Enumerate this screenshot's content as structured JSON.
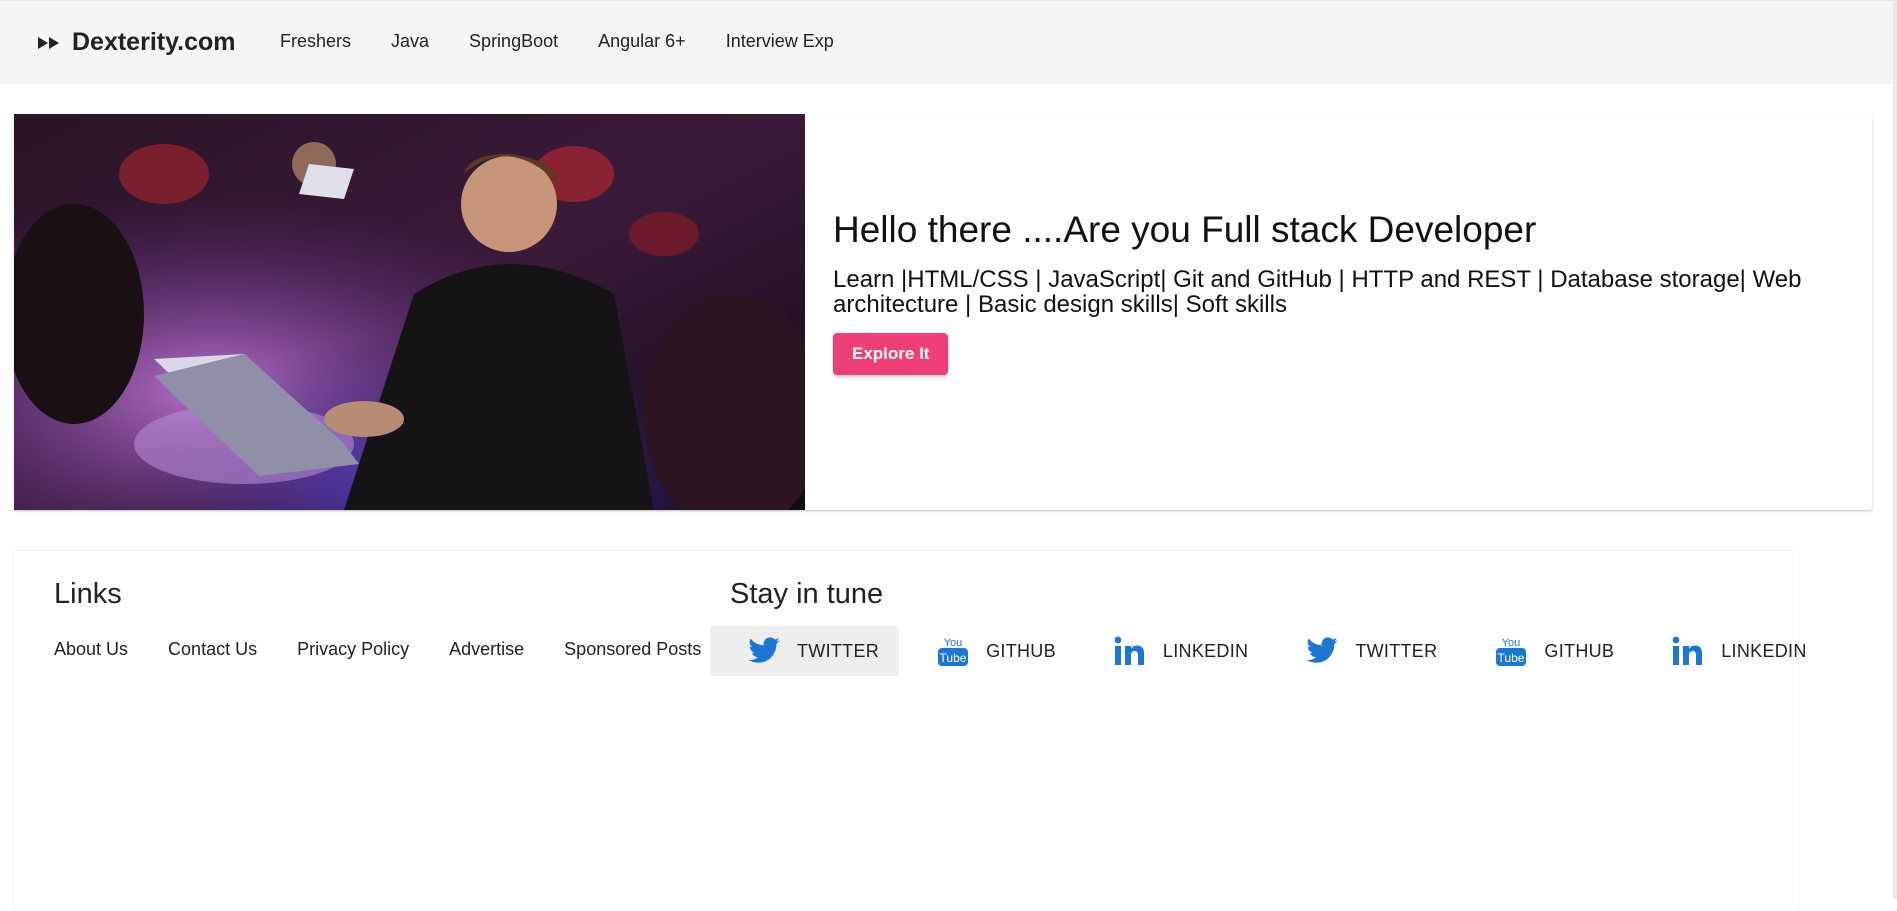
{
  "brand": {
    "name": "Dexterity.com",
    "icon": "fast-forward-icon"
  },
  "nav": {
    "items": [
      {
        "label": "Freshers"
      },
      {
        "label": "Java"
      },
      {
        "label": "SpringBoot"
      },
      {
        "label": "Angular 6+"
      },
      {
        "label": "Interview Exp"
      }
    ]
  },
  "hero": {
    "image": "developer-working-on-laptop-photo",
    "title": "Hello there ....Are you Full stack Developer",
    "subtitle": "Learn |HTML/CSS | JavaScript| Git and GitHub | HTTP and REST | Database storage| Web architecture | Basic design skills| Soft skills",
    "button_label": "Explore It"
  },
  "footer": {
    "links_title": "Links",
    "links": [
      {
        "label": "About Us"
      },
      {
        "label": "Contact Us"
      },
      {
        "label": "Privacy Policy"
      },
      {
        "label": "Advertise"
      },
      {
        "label": "Sponsored Posts"
      }
    ],
    "social_title": "Stay in tune",
    "social": [
      {
        "label": "TWITTER",
        "icon": "twitter-icon"
      },
      {
        "label": "GITHUB",
        "icon": "youtube-icon"
      },
      {
        "label": "LINKEDIN",
        "icon": "linkedin-icon"
      },
      {
        "label": "TWITTER",
        "icon": "twitter-icon"
      },
      {
        "label": "GITHUB",
        "icon": "youtube-icon"
      },
      {
        "label": "LINKEDIN",
        "icon": "linkedin-icon"
      }
    ]
  },
  "colors": {
    "navbar_bg": "#f5f5f5",
    "accent_button": "#ee4075",
    "social_blue": "#1d76d2"
  }
}
